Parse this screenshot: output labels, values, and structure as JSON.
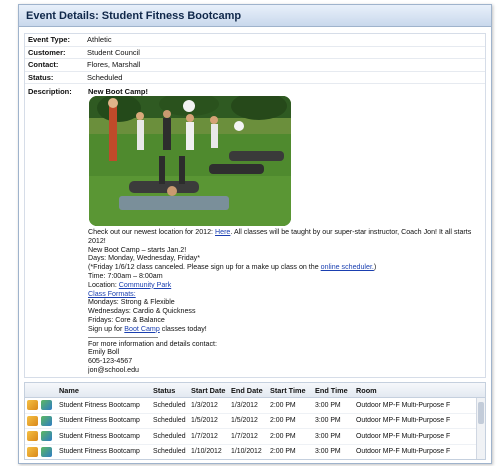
{
  "panel": {
    "title": "Event Details: Student Fitness Bootcamp"
  },
  "details": {
    "fields": [
      {
        "label": "Event Type:",
        "value": "Athletic"
      },
      {
        "label": "Customer:",
        "value": "Student Council"
      },
      {
        "label": "Contact:",
        "value": "Flores, Marshall"
      },
      {
        "label": "Status:",
        "value": "Scheduled"
      }
    ],
    "description_label": "Description:",
    "description_heading": "New Boot Camp!",
    "description": {
      "line1_pre": "Check out our newest location for 2012:",
      "line1_link": "Here",
      "line1_post": ". All classes will be taught by our super-star instructor, Coach Jon! It all starts 2012!",
      "line2": "New Boot Camp – starts Jan.2!",
      "line3": "Days: Monday, Wednesday, Friday*",
      "line4_pre": "(*Friday 1/6/12 class canceled. Please sign up for a make up class on the",
      "line4_link": "online scheduler.",
      "line4_post": ")",
      "line5": "Time: 7:00am – 8:00am",
      "line6_pre": "Location:",
      "line6_link": "Community Park",
      "line7_link": "Class Formats:",
      "line8": "Mondays: Strong & Flexible",
      "line9": "Wednesdays: Cardio & Quickness",
      "line10": "Fridays: Core & Balance",
      "line11_pre": "Sign up for",
      "line11_link": "Boot Camp",
      "line11_post": "classes today!",
      "line12": "For more information and details contact:",
      "line13": "Emily Boll",
      "line14": "605-123-4567",
      "line15": "jon@school.edu"
    }
  },
  "grid": {
    "headers": {
      "name": "Name",
      "status": "Status",
      "start_date": "Start Date",
      "end_date": "End Date",
      "start_time": "Start Time",
      "end_time": "End Time",
      "room": "Room"
    },
    "rows": [
      {
        "name": "Student Fitness Bootcamp",
        "status": "Scheduled",
        "start_date": "1/3/2012",
        "end_date": "1/3/2012",
        "start_time": "2:00 PM",
        "end_time": "3:00 PM",
        "room": "Outdoor MP-F Multi-Purpose F"
      },
      {
        "name": "Student Fitness Bootcamp",
        "status": "Scheduled",
        "start_date": "1/5/2012",
        "end_date": "1/5/2012",
        "start_time": "2:00 PM",
        "end_time": "3:00 PM",
        "room": "Outdoor MP-F Multi-Purpose F"
      },
      {
        "name": "Student Fitness Bootcamp",
        "status": "Scheduled",
        "start_date": "1/7/2012",
        "end_date": "1/7/2012",
        "start_time": "2:00 PM",
        "end_time": "3:00 PM",
        "room": "Outdoor MP-F Multi-Purpose F"
      },
      {
        "name": "Student Fitness Bootcamp",
        "status": "Scheduled",
        "start_date": "1/10/2012",
        "end_date": "1/10/2012",
        "start_time": "2:00 PM",
        "end_time": "3:00 PM",
        "room": "Outdoor MP-F Multi-Purpose F"
      }
    ]
  },
  "icons": {
    "edit": "edit-icon",
    "view": "view-icon"
  },
  "colors": {
    "title_bg": "#c9d8ec",
    "link": "#1a3fb0",
    "border": "#9fb3cc"
  }
}
